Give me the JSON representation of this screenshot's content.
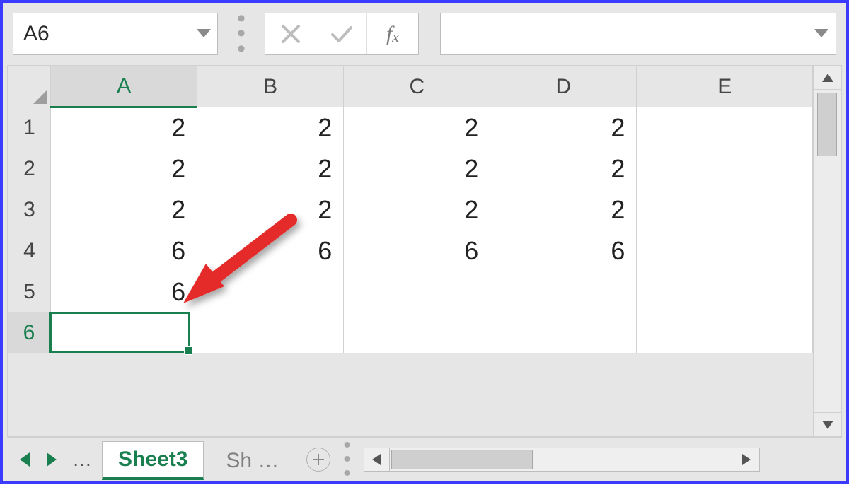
{
  "namebox": {
    "value": "A6"
  },
  "formula": {
    "value": ""
  },
  "columns": [
    "A",
    "B",
    "C",
    "D",
    "E"
  ],
  "rows": [
    "1",
    "2",
    "3",
    "4",
    "5",
    "6"
  ],
  "selected_cell": "A6",
  "selected_col_index": 0,
  "selected_row_index": 5,
  "cells": {
    "A1": "2",
    "B1": "2",
    "C1": "2",
    "D1": "2",
    "A2": "2",
    "B2": "2",
    "C2": "2",
    "D2": "2",
    "A3": "2",
    "B3": "2",
    "C3": "2",
    "D3": "2",
    "A4": "6",
    "B4": "6",
    "C4": "6",
    "D4": "6",
    "A5": "6"
  },
  "tabs": {
    "active": "Sheet3",
    "truncated": "Sh …"
  },
  "chart_data": {
    "type": "table",
    "columns": [
      "A",
      "B",
      "C",
      "D",
      "E"
    ],
    "rows": [
      [
        2,
        2,
        2,
        2,
        null
      ],
      [
        2,
        2,
        2,
        2,
        null
      ],
      [
        2,
        2,
        2,
        2,
        null
      ],
      [
        6,
        6,
        6,
        6,
        null
      ],
      [
        6,
        null,
        null,
        null,
        null
      ],
      [
        null,
        null,
        null,
        null,
        null
      ]
    ],
    "active_cell": "A6"
  }
}
